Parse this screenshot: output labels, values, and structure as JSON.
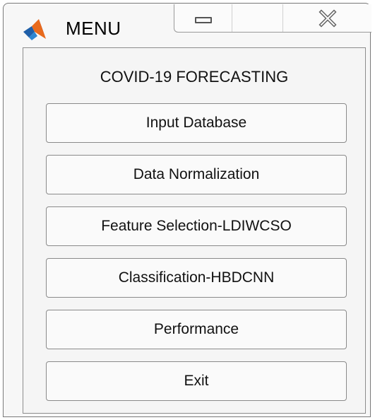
{
  "window": {
    "title": "MENU",
    "app_icon": "matlab-logo-icon",
    "caption_buttons": {
      "minimize_icon": "minimize-icon",
      "close_icon": "close-icon"
    }
  },
  "panel": {
    "heading": "COVID-19 FORECASTING",
    "buttons": [
      {
        "label": "Input Database"
      },
      {
        "label": "Data Normalization"
      },
      {
        "label": "Feature Selection-LDIWCSO"
      },
      {
        "label": "Classification-HBDCNN"
      },
      {
        "label": "Performance"
      },
      {
        "label": "Exit"
      }
    ]
  },
  "colors": {
    "window_background": "#f7f7f7",
    "button_background": "#fafafa",
    "border": "#8a8a8a",
    "text": "#111111"
  }
}
